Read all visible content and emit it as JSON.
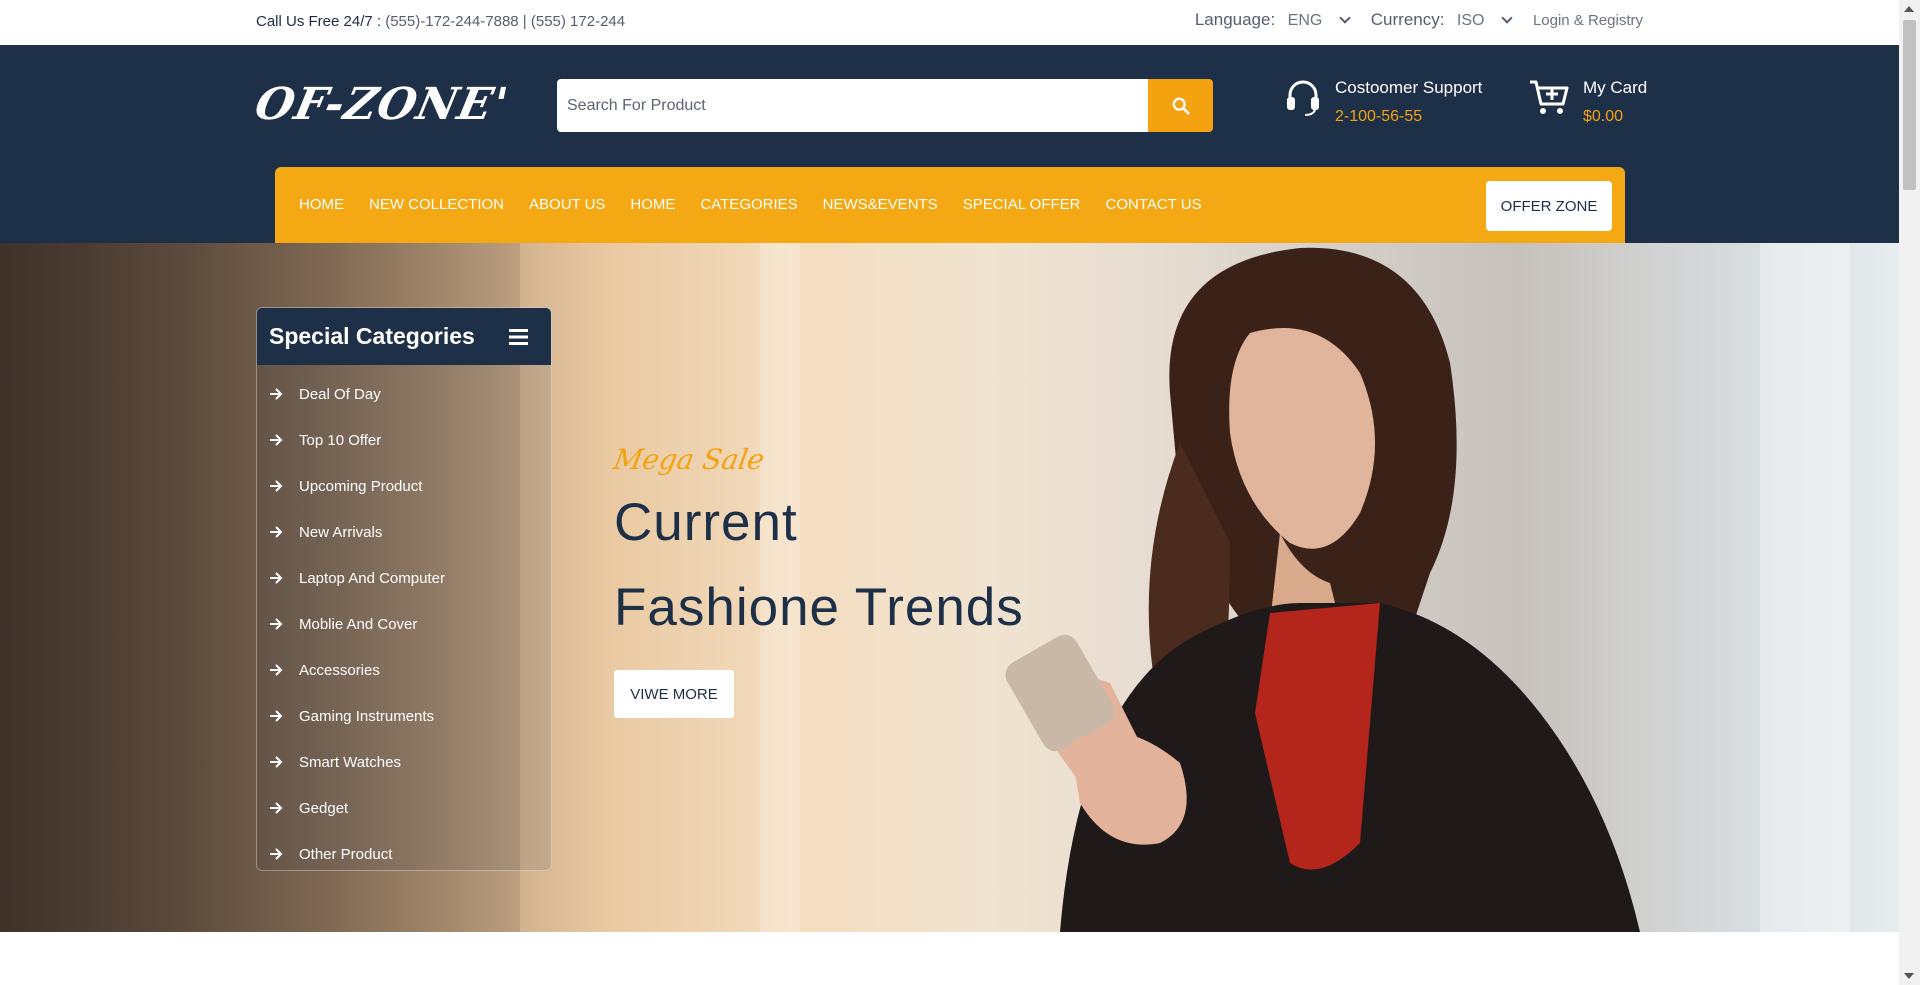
{
  "topbar": {
    "call_label": "Call Us Free 24/7 :",
    "phones": "(555)-172-244-7888 | (555) 172-244",
    "language_label": "Language:",
    "language_value": "ENG",
    "currency_label": "Currency:",
    "currency_value": "ISO",
    "login": "Login & Registry"
  },
  "header": {
    "logo": "OF-ZONE'",
    "search_placeholder": "Search For Product",
    "support_title": "Costoomer Support",
    "support_phone": "2-100-56-55",
    "cart_title": "My Card",
    "cart_amount": "$0.00"
  },
  "nav": {
    "items": [
      "HOME",
      "NEW COLLECTION",
      "ABOUT US",
      "HOME",
      "CATEGORIES",
      "NEWS&EVENTS",
      "SPECIAL OFFER",
      "CONTACT US"
    ],
    "offer_button": "OFFER ZONE"
  },
  "categories": {
    "title": "Special Categories",
    "items": [
      "Deal Of Day",
      "Top 10 Offer",
      "Upcoming Product",
      "New Arrivals",
      "Laptop And Computer",
      "Moblie And Cover",
      "Accessories",
      "Gaming Instruments",
      "Smart Watches",
      "Gedget",
      "Other Product"
    ]
  },
  "hero": {
    "kicker": "Mega Sale",
    "line1": "Current",
    "line2": "Fashione Trends",
    "button": "VIWE MORE"
  },
  "colors": {
    "navy": "#1e2f48",
    "accent": "#f4a813"
  }
}
